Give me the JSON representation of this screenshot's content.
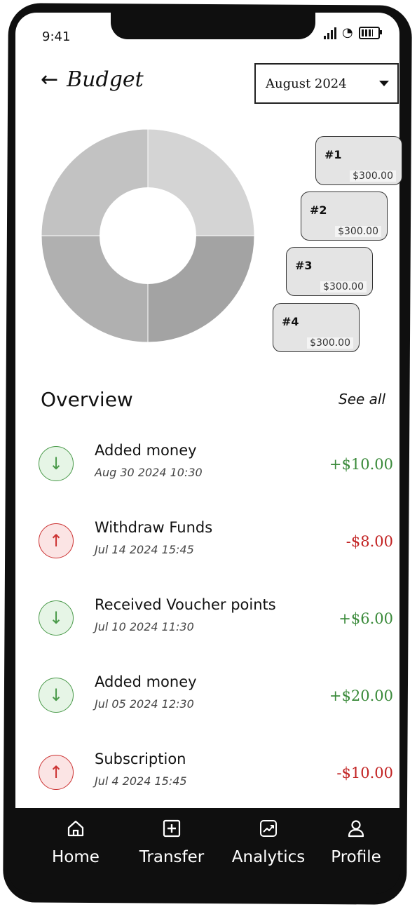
{
  "status": {
    "time": "9:41"
  },
  "header": {
    "title": "Budget",
    "month": "August 2024"
  },
  "chart_data": {
    "type": "pie",
    "categories": [
      "#1",
      "#2",
      "#3",
      "#4"
    ],
    "values": [
      300,
      300,
      300,
      300
    ],
    "labels": [
      "$300.00",
      "$300.00",
      "$300.00",
      "$300.00"
    ],
    "colors": [
      "#d4d4d4",
      "#a3a3a3",
      "#b0b0b0",
      "#c2c2c2"
    ]
  },
  "overview": {
    "title": "Overview",
    "see_all": "See all",
    "items": [
      {
        "title": "Added money",
        "date": "Aug 30 2024 10:30",
        "amount": "+$10.00",
        "direction": "in"
      },
      {
        "title": "Withdraw Funds",
        "date": "Jul 14 2024 15:45",
        "amount": "-$8.00",
        "direction": "out"
      },
      {
        "title": "Received Voucher points",
        "date": "Jul 10 2024 11:30",
        "amount": "+$6.00",
        "direction": "in"
      },
      {
        "title": "Added money",
        "date": "Jul 05 2024 12:30",
        "amount": "+$20.00",
        "direction": "in"
      },
      {
        "title": "Subscription",
        "date": "Jul 4 2024 15:45",
        "amount": "-$10.00",
        "direction": "out"
      }
    ]
  },
  "nav": {
    "items": [
      {
        "label": "Home",
        "icon": "home-icon"
      },
      {
        "label": "Transfer",
        "icon": "plus-square-icon"
      },
      {
        "label": "Analytics",
        "icon": "chart-trend-icon"
      },
      {
        "label": "Profile",
        "icon": "user-icon"
      }
    ]
  },
  "colors": {
    "positive": "#3a8a3a",
    "negative": "#c22222",
    "dark": "#0f0f0f"
  }
}
